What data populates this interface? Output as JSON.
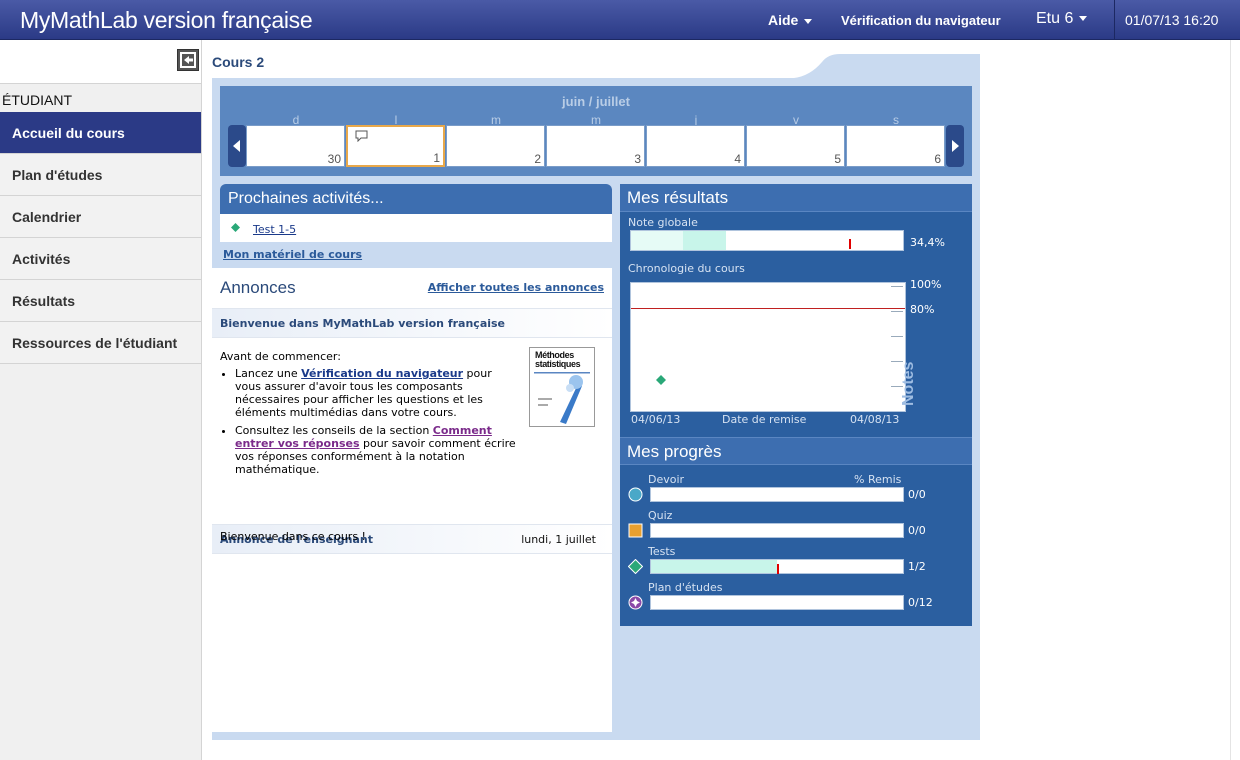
{
  "header": {
    "app_title": "MyMathLab version française",
    "help_label": "Aide",
    "browser_check_label": "Vérification du navigateur",
    "user_label": "Etu 6",
    "datetime": "01/07/13 16:20"
  },
  "sidebar": {
    "section_label": "ÉTUDIANT",
    "items": [
      {
        "label": "Accueil du cours",
        "active": true
      },
      {
        "label": "Plan d'études",
        "active": false
      },
      {
        "label": "Calendrier",
        "active": false
      },
      {
        "label": "Activités",
        "active": false
      },
      {
        "label": "Résultats",
        "active": false
      },
      {
        "label": "Ressources de l'étudiant",
        "active": false
      }
    ]
  },
  "course": {
    "title": "Cours 2"
  },
  "calendar": {
    "month_label": "juin / juillet",
    "weekdays": [
      "d",
      "l",
      "m",
      "m",
      "j",
      "v",
      "s"
    ],
    "days": [
      "30",
      "1",
      "2",
      "3",
      "4",
      "5",
      "6"
    ],
    "today_index": 1
  },
  "upcoming": {
    "title": "Prochaines activités...",
    "items": [
      "Test 1-5"
    ],
    "materials_link": "Mon matériel de cours"
  },
  "announcements": {
    "title": "Annonces",
    "show_all": "Afficher toutes les annonces",
    "welcome_heading": "Bienvenue dans MyMathLab version française",
    "intro": "Avant de commencer:",
    "bullet1_pre": "Lancez une ",
    "bullet1_link": "Vérification du navigateur",
    "bullet1_post": " pour vous assurer d'avoir tous les composants nécessaires pour afficher les questions et les éléments multimédias dans votre cours.",
    "bullet2_pre": "Consultez les conseils de la section ",
    "bullet2_link": "Comment entrer vos réponses",
    "bullet2_post": " pour savoir comment écrire vos réponses conformément à la notation mathématique.",
    "book_title": "Méthodes statistiques",
    "teacher_heading": "Annonce de l'enseignant",
    "teacher_date": "lundi, 1 juillet",
    "teacher_body": "Bienvenue dans ce cours !"
  },
  "results": {
    "title": "Mes résultats",
    "overall_label": "Note globale",
    "overall_value": "34,4%",
    "overall_fraction": 0.344,
    "timeline_label": "Chronologie du cours",
    "pct_100": "100%",
    "pct_80": "80%",
    "start_date": "04/06/13",
    "due_label": "Date de remise",
    "end_date": "04/08/13",
    "notes_label": "Notes"
  },
  "progress": {
    "title": "Mes progrès",
    "submitted_label": "% Remis",
    "items": [
      {
        "label": "Devoir",
        "value": "0/0",
        "fraction": 0,
        "icon": "circle-teal-icon",
        "color": "#4aa8c8"
      },
      {
        "label": "Quiz",
        "value": "0/0",
        "fraction": 0,
        "icon": "square-orange-icon",
        "color": "#e8a030"
      },
      {
        "label": "Tests",
        "value": "1/2",
        "fraction": 0.5,
        "icon": "diamond-green-icon",
        "color": "#2aa878"
      },
      {
        "label": "Plan d'études",
        "value": "0/12",
        "fraction": 0,
        "icon": "star-purple-icon",
        "color": "#8a4aa8"
      }
    ]
  },
  "colors": {
    "header_bg": "#2b3a86",
    "accent": "#3d6eb0",
    "progress_fill": "#c8f5ea",
    "marker": "#e00000"
  }
}
